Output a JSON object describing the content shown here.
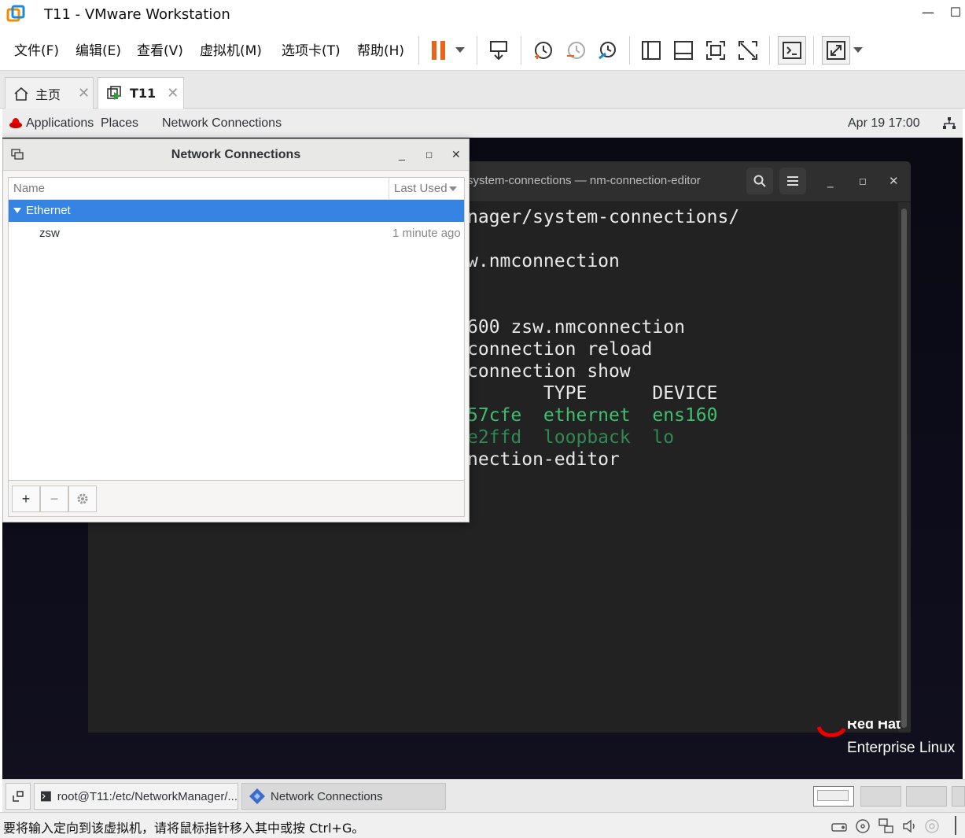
{
  "window": {
    "title": "T11 - VMware Workstation"
  },
  "menu": [
    "文件(F)",
    "编辑(E)",
    "查看(V)",
    "虚拟机(M)",
    "选项卡(T)",
    "帮助(H)"
  ],
  "tabs": {
    "home": "主页",
    "vm": "T11"
  },
  "gnome": {
    "applications": "Applications",
    "places": "Places",
    "active_app": "Network Connections",
    "clock": "Apr 19  17:00"
  },
  "terminal": {
    "title": "system-connections — nm-connection-editor",
    "lines": [
      {
        "text": "nager/system-connections/",
        "color": "#e8e8e8"
      },
      {
        "text": "",
        "color": "#e8e8e8"
      },
      {
        "text": "w.nmconnection",
        "color": "#e8e8e8"
      },
      {
        "text": "",
        "color": "#e8e8e8"
      },
      {
        "text": "",
        "color": "#e8e8e8"
      },
      {
        "text": "600 zsw.nmconnection",
        "color": "#e8e8e8"
      },
      {
        "text": "connection reload",
        "color": "#e8e8e8"
      },
      {
        "text": "connection show",
        "color": "#e8e8e8"
      },
      {
        "text": "       TYPE      DEVICE",
        "color": "#e8e8e8"
      },
      {
        "text": "57cfe  ethernet  ens160",
        "color": "#3fbf6f"
      },
      {
        "text": "e2ffd  loopback  lo",
        "color": "#2e8a52"
      },
      {
        "text": "nection-editor",
        "color": "#e8e8e8"
      }
    ]
  },
  "nm_dialog": {
    "title": "Network Connections",
    "col_name": "Name",
    "col_last_used": "Last Used",
    "group": "Ethernet",
    "connection_name": "zsw",
    "connection_last_used": "1 minute ago",
    "add": "+",
    "remove": "−"
  },
  "branding": {
    "line1": "Red Hat",
    "line2": "Enterprise Linux"
  },
  "taskbar": {
    "terminal_task": "root@T11:/etc/NetworkManager/...",
    "nm_task": "Network Connections"
  },
  "statusbar": {
    "message": "要将输入定向到该虚拟机，请将鼠标指针移入其中或按 Ctrl+G。"
  },
  "colors": {
    "accent": "#3584e4",
    "pause": "#e8641b",
    "redhat": "#ee0000"
  }
}
